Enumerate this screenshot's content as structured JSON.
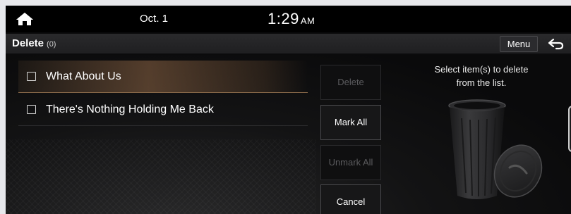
{
  "status": {
    "date": "Oct. 1",
    "time": "1:29",
    "ampm": "AM",
    "home_icon": "home-icon"
  },
  "header": {
    "title": "Delete",
    "count": "(0)",
    "menu_label": "Menu",
    "back_icon": "back-icon"
  },
  "list": {
    "items": [
      {
        "label": "What About Us",
        "checked": false,
        "highlighted": true
      },
      {
        "label": "There's Nothing Holding Me Back",
        "checked": false,
        "highlighted": false
      }
    ]
  },
  "actions": {
    "delete_label": "Delete",
    "mark_all_label": "Mark All",
    "unmark_all_label": "Unmark All",
    "cancel_label": "Cancel"
  },
  "panel": {
    "hint_line1": "Select item(s) to delete",
    "hint_line2": "from the list.",
    "illustration_icon": "trash-can-icon"
  },
  "colors": {
    "accent_highlight": "#a97a50",
    "text": "#ffffff",
    "disabled_text": "#5b5b5e"
  }
}
